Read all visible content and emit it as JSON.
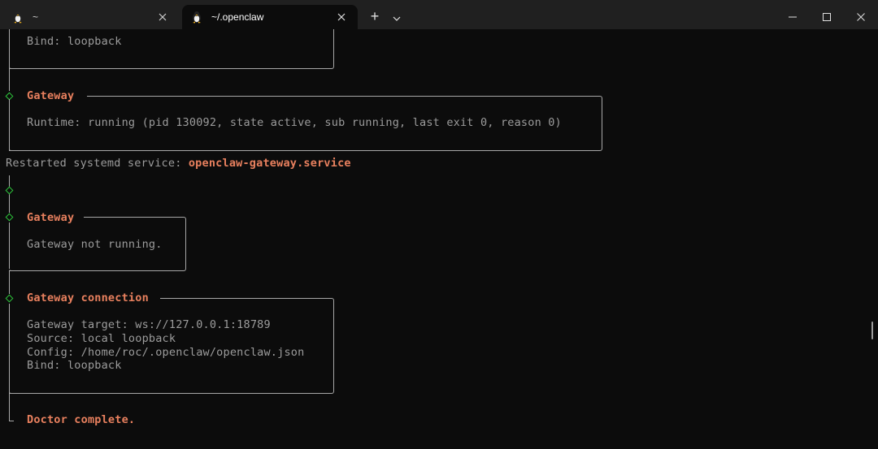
{
  "tabs": [
    {
      "label": "~",
      "icon": "linux-penguin-icon",
      "active": false
    },
    {
      "label": "~/.openclaw",
      "icon": "linux-penguin-icon",
      "active": true
    }
  ],
  "window_controls": {
    "new_tab": "+",
    "dropdown": "chevron-down-icon",
    "minimize": "minimize-icon",
    "maximize": "maximize-icon",
    "close": "close-icon"
  },
  "terminal": {
    "bind_top": "Bind: loopback",
    "gateway1": {
      "title": "Gateway",
      "runtime": "Runtime: running (pid 130092, state active, sub running, last exit 0, reason 0)"
    },
    "restarted_prefix": "Restarted systemd service: ",
    "restarted_service": "openclaw-gateway.service",
    "gateway2": {
      "title": "Gateway",
      "status": "Gateway not running."
    },
    "connection": {
      "title": "Gateway connection",
      "lines": [
        "Gateway target: ws://127.0.0.1:18789",
        "Source: local loopback",
        "Config: /home/roc/.openclaw/openclaw.json",
        "Bind: loopback"
      ]
    },
    "doctor_complete": "Doctor complete."
  },
  "colors": {
    "background": "#0c0c0c",
    "titlebar": "#202020",
    "accent_orange": "#e8805e",
    "text_gray": "#9c9c9c",
    "diamond_green": "#2cc23a"
  }
}
